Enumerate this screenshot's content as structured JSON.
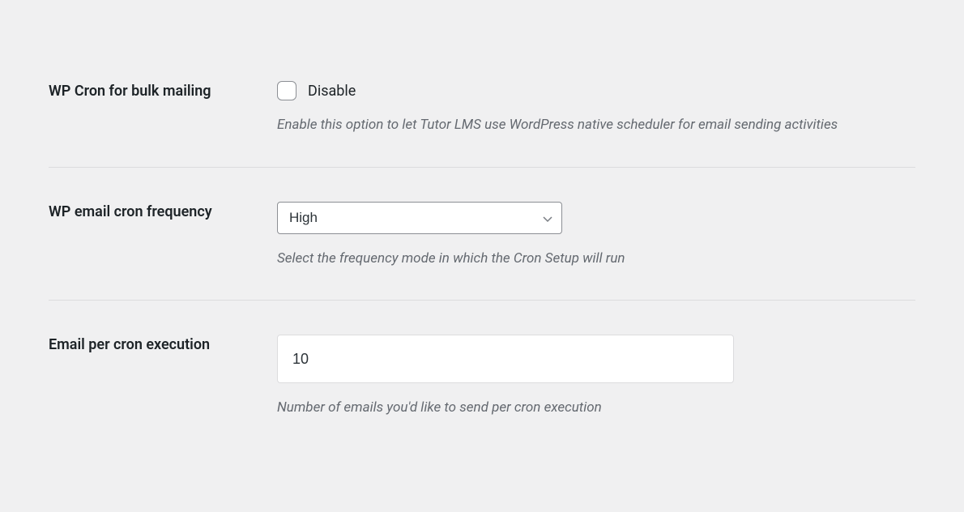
{
  "settings": {
    "wp_cron_bulk_mailing": {
      "label": "WP Cron for bulk mailing",
      "checkbox_label": "Disable",
      "help_text": "Enable this option to let Tutor LMS use WordPress native scheduler for email sending activities"
    },
    "wp_email_cron_frequency": {
      "label": "WP email cron frequency",
      "selected_value": "High",
      "help_text": "Select the frequency mode in which the Cron Setup will run"
    },
    "email_per_cron_execution": {
      "label": "Email per cron execution",
      "value": "10",
      "help_text": "Number of emails you'd like to send per cron execution"
    }
  }
}
